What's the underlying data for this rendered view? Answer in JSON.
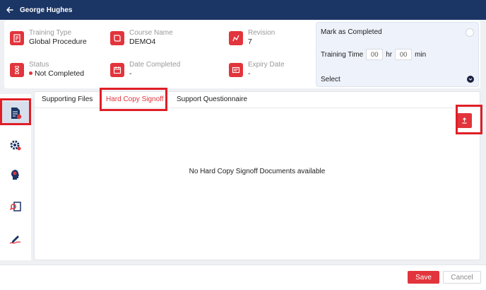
{
  "header": {
    "title": "George Hughes",
    "back_icon": "arrow-left-icon"
  },
  "info": {
    "training_type": {
      "label": "Training Type",
      "value": "Global Procedure",
      "icon": "procedure-icon"
    },
    "course_name": {
      "label": "Course Name",
      "value": "DEMO4",
      "icon": "book-icon"
    },
    "revision": {
      "label": "Revision",
      "value": "7",
      "icon": "revision-icon"
    },
    "status": {
      "label": "Status",
      "value": "Not Completed",
      "icon": "hourglass-icon",
      "status_color": "#e2343c"
    },
    "date_completed": {
      "label": "Date Completed",
      "value": "-",
      "icon": "calendar-icon"
    },
    "expiry_date": {
      "label": "Expiry Date",
      "value": "-",
      "icon": "expiry-icon"
    }
  },
  "completion": {
    "mark_label": "Mark as Completed",
    "training_time_label": "Training Time",
    "hours_value": "00",
    "hours_unit": "hr",
    "minutes_value": "00",
    "minutes_unit": "min",
    "select_label": "Select"
  },
  "sidenav": {
    "items": [
      {
        "icon": "document-info-icon",
        "active": true
      },
      {
        "icon": "settings-gear-icon",
        "active": false
      },
      {
        "icon": "head-gear-icon",
        "active": false
      },
      {
        "icon": "search-document-icon",
        "active": false
      },
      {
        "icon": "signature-icon",
        "active": false
      }
    ]
  },
  "tabs": [
    {
      "label": "Supporting Files",
      "active": false
    },
    {
      "label": "Hard Copy Signoff",
      "active": true
    },
    {
      "label": "Support Questionnaire",
      "active": false
    }
  ],
  "main": {
    "empty_message": "No Hard Copy Signoff Documents available",
    "upload_icon": "upload-icon"
  },
  "footer": {
    "save_label": "Save",
    "cancel_label": "Cancel"
  },
  "colors": {
    "header_bg": "#1b3565",
    "accent": "#e2343c",
    "highlight": "#e01e26"
  }
}
